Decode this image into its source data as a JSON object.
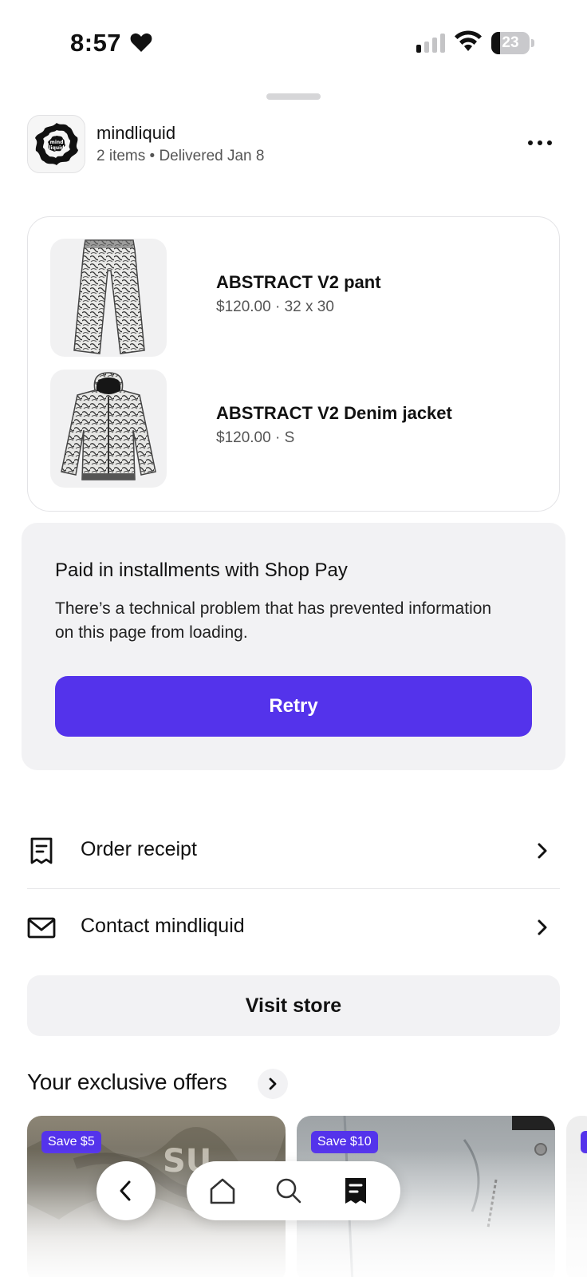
{
  "status_bar": {
    "time": "8:57",
    "battery_level": "23",
    "battery_fraction": 0.23
  },
  "store": {
    "name": "mindliquid",
    "subtitle": "2 items • Delivered Jan 8"
  },
  "items": [
    {
      "name": "ABSTRACT V2 pant",
      "meta": "$120.00 · 32 x 30"
    },
    {
      "name": "ABSTRACT V2 Denim jacket",
      "meta": "$120.00 · S"
    }
  ],
  "shop_pay": {
    "title": "Paid in installments with Shop Pay",
    "message": "There’s a technical problem that has prevented information on this page from loading.",
    "retry_label": "Retry"
  },
  "actions": [
    {
      "label": "Order receipt",
      "icon": "receipt-icon"
    },
    {
      "label": "Contact mindliquid",
      "icon": "mail-icon"
    }
  ],
  "visit_store_label": "Visit store",
  "offers": {
    "title": "Your exclusive offers",
    "cards": [
      {
        "badge": "Save $5"
      },
      {
        "badge": "Save $10"
      }
    ]
  },
  "bottom_nav": {
    "items": [
      "back-icon",
      "home-icon",
      "search-icon",
      "orders-icon"
    ]
  },
  "colors": {
    "accent": "#5433eb",
    "card_gray": "#f2f2f4",
    "text_secondary": "#555555"
  }
}
